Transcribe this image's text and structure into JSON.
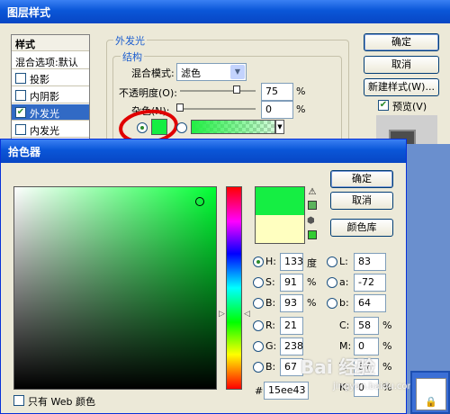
{
  "layer_style": {
    "title": "图层样式",
    "sidebar": {
      "header": "样式",
      "items": [
        {
          "label": "混合选项:默认",
          "checkbox": false,
          "checked": false
        },
        {
          "label": "投影",
          "checkbox": true,
          "checked": false
        },
        {
          "label": "内阴影",
          "checkbox": true,
          "checked": false
        },
        {
          "label": "外发光",
          "checkbox": true,
          "checked": true
        },
        {
          "label": "内发光",
          "checkbox": true,
          "checked": false
        }
      ]
    },
    "outer_glow": {
      "group_title": "外发光",
      "sub_title": "结构",
      "blend_mode_label": "混合模式:",
      "blend_mode_value": "滤色",
      "opacity_label": "不透明度(O):",
      "opacity_value": "75",
      "opacity_percent": 75,
      "noise_label": "杂色(N):",
      "noise_value": "0",
      "noise_percent": 0,
      "percent_sign": "%",
      "color_swatch": "#15ee43"
    },
    "buttons": {
      "ok": "确定",
      "cancel": "取消",
      "new_style": "新建样式(W)...",
      "preview": "预览(V)"
    }
  },
  "color_picker": {
    "title": "拾色器",
    "buttons": {
      "ok": "确定",
      "cancel": "取消",
      "library": "颜色库"
    },
    "new_color": "#15ee43",
    "old_color": "#ffffc0",
    "web_safe_color": "#33cc33",
    "hsb": {
      "h": {
        "label": "H:",
        "value": "133",
        "unit": "度"
      },
      "s": {
        "label": "S:",
        "value": "91",
        "unit": "%"
      },
      "b": {
        "label": "B:",
        "value": "93",
        "unit": "%"
      }
    },
    "rgb": {
      "r": {
        "label": "R:",
        "value": "21"
      },
      "g": {
        "label": "G:",
        "value": "238"
      },
      "b": {
        "label": "B:",
        "value": "67"
      }
    },
    "lab": {
      "l": {
        "label": "L:",
        "value": "83"
      },
      "a": {
        "label": "a:",
        "value": "-72"
      },
      "b": {
        "label": "b:",
        "value": "64"
      }
    },
    "cmyk": {
      "c": {
        "label": "C:",
        "value": "58",
        "unit": "%"
      },
      "m": {
        "label": "M:",
        "value": "0",
        "unit": "%"
      },
      "y": {
        "label": "Y:",
        "value": "87",
        "unit": "%"
      },
      "k": {
        "label": "K:",
        "value": "0",
        "unit": "%"
      }
    },
    "hex_label": "#",
    "hex_value": "15ee43",
    "web_only_label": "只有 Web 颜色"
  },
  "watermark": "Bai 经验",
  "watermark_sub": "jingyan.baidu.com"
}
